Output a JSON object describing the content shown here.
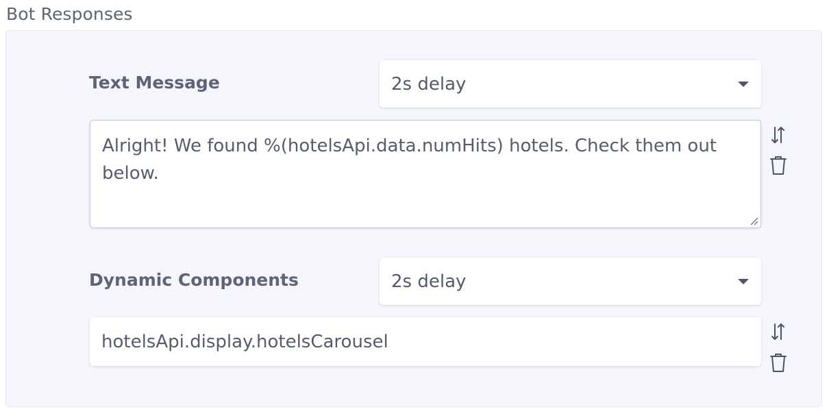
{
  "section": {
    "title": "Bot Responses"
  },
  "responses": [
    {
      "label": "Text Message",
      "delay": "2s delay",
      "content_type": "textarea",
      "value": "Alright! We found %(hotelsApi.data.numHits) hotels. Check them out below."
    },
    {
      "label": "Dynamic Components",
      "delay": "2s delay",
      "content_type": "input",
      "value": "hotelsApi.display.hotelsCarousel"
    }
  ],
  "icons": {
    "reorder": "sort-arrows-icon",
    "delete": "trash-icon"
  },
  "colors": {
    "panel_bg": "#f4f6fc",
    "text": "#5d6478",
    "field_bg": "#ffffff"
  }
}
